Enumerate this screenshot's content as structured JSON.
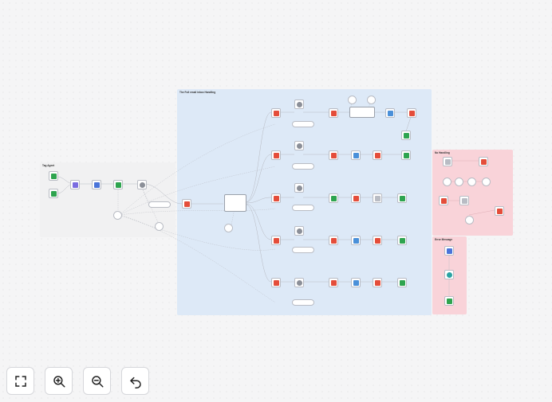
{
  "stickies": {
    "tag_agent": "Tag Agent",
    "full_email": "The Full email inbox Handling",
    "no_handling": "No Handling",
    "error_message": "Error Message"
  },
  "controls": {
    "fit_view": "fit-view",
    "zoom_in": "zoom-in",
    "zoom_out": "zoom-out",
    "undo": "undo"
  },
  "colors": {
    "blue_sticky": "#dde9f7",
    "pink_sticky": "#f9d3d9",
    "gray_sticky": "#f1f1f2",
    "accent_red": "#e44d3a",
    "accent_green": "#2ea44f",
    "accent_blue": "#4a90d9"
  }
}
